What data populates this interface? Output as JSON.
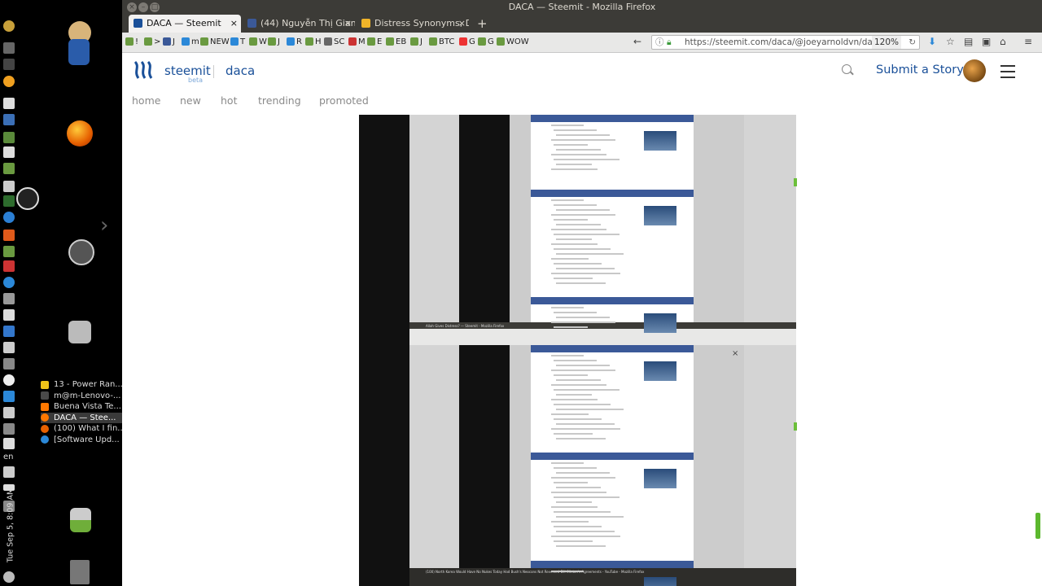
{
  "system_panel": {
    "language": "en",
    "clock": "Tue Sep 5, 8:09 AM",
    "windows": [
      {
        "label": "13 - Power Ran...",
        "active": false,
        "color": "#f0c419"
      },
      {
        "label": "m@m-Lenovo-...",
        "active": false,
        "color": "#4a4a4a"
      },
      {
        "label": "Buena Vista Te...",
        "active": false,
        "color": "#ff7800"
      },
      {
        "label": "DACA — Stee...",
        "active": true,
        "color": "#ff7800"
      },
      {
        "label": "(100) What I fin...",
        "active": false,
        "color": "#e66000"
      },
      {
        "label": "[Software Upd...",
        "active": false,
        "color": "#2b88d8"
      }
    ]
  },
  "browser": {
    "window_title": "DACA — Steemit - Mozilla Firefox",
    "tabs": [
      {
        "label": "DACA — Steemit",
        "active": true,
        "favicon_color": "#1a5099"
      },
      {
        "label": "(44) Nguyễn Thị Giang",
        "active": false,
        "favicon_color": "#3b5998"
      },
      {
        "label": "Distress Synonyms, Di",
        "active": false,
        "favicon_color": "#f0b429"
      }
    ],
    "bookmarks": [
      "!",
      ">",
      "J",
      "m",
      "NEW",
      "T",
      "W",
      "J",
      "R",
      "H",
      "SC",
      "M",
      "E",
      "EB",
      "J",
      "BTC",
      "G",
      "G",
      "WOW"
    ],
    "url": "https://steemit.com/daca/@joeyarnoldvn/da",
    "zoom": "120%"
  },
  "steemit": {
    "brand": "steemit",
    "beta": "beta",
    "tag": "daca",
    "submit_label": "Submit a Story",
    "nav": [
      "home",
      "new",
      "hot",
      "trending",
      "promoted"
    ]
  },
  "embedded": {
    "inner_title": "Allah Gives Distress? — Steemit - Mozilla Firefox",
    "bottom_title": "(100) North Korea Would Have No Nukes Today Had Bush's Neocons Not Reversed Bill Clinton's Agreements - YouTube - Mozilla Firefox"
  },
  "colors": {
    "accent": "#1a5099",
    "facebook": "#3b5998",
    "scrollbar": "#5cb82e"
  }
}
